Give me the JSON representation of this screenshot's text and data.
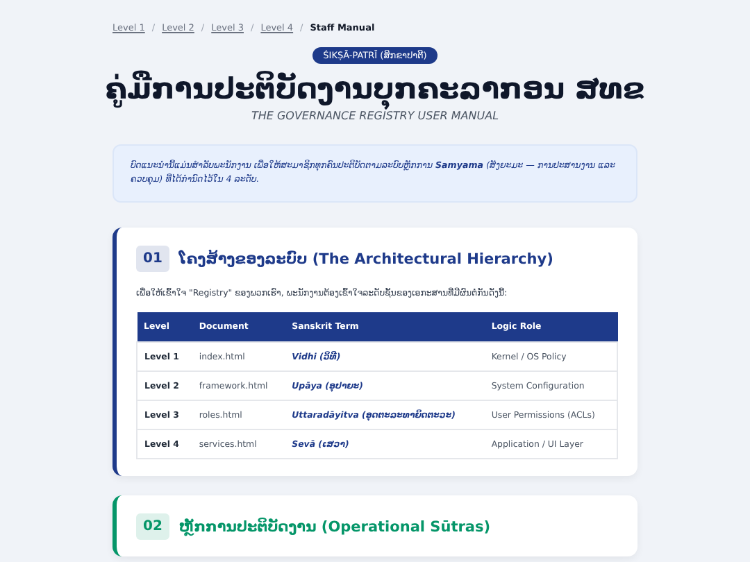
{
  "breadcrumb": {
    "separator": "/",
    "items": [
      {
        "label": "Level 1",
        "current": false
      },
      {
        "label": "Level 2",
        "current": false
      },
      {
        "label": "Level 3",
        "current": false
      },
      {
        "label": "Level 4",
        "current": false
      },
      {
        "label": "Staff Manual",
        "current": true
      }
    ]
  },
  "header": {
    "badge": "ŚIKṢĀ-PATRĪ (ສິກຂາປາຕີ)",
    "title": "ຄູ່ມືການປະຕິບັດງານບຸກຄະລາກອນ ສທຂ",
    "subtitle": "THE GOVERNANCE REGISTRY USER MANUAL"
  },
  "intro": "ບົດແນະນຳນີ້ແມ່ນສຳລັບພະນັກງານ ເພື່ອໃຫ້ສະມາຊິກທຸກຄົນປະຕິບັດຕາມລະບົບຫຼັກການ **Samyama** (ສັງຍະມະ — ການປະສານງານ ແລະ ຄວບຄຸມ) ທີ່ໄດ້ກຳນົດໄວ້ໃນ 4 ລະດັບ.",
  "sections": [
    {
      "number": "01",
      "title": "ໂຄງສ້າງຂອງລະບົບ (The Architectural Hierarchy)",
      "color": "#1e3a8a",
      "text": "ເພື່ອໃຫ້ເຂົ້າໃຈ \"Registry\" ຂອງພວກເຮົາ, ພະນັກງານຕ້ອງເຂົ້າໃຈລະດັບຊັ້ນຂອງເອກະສານທີ່ມີຜົນຕໍ່ກັນດັ່ງນີ້:",
      "table": {
        "columns": [
          "Level",
          "Document",
          "Sanskrit Term",
          "Logic Role"
        ],
        "rows": [
          [
            "Level 1",
            "index.html",
            "Vidhi (ວິທີ)",
            "Kernel / OS Policy"
          ],
          [
            "Level 2",
            "framework.html",
            "Upāya (ອຸປາຍະ)",
            "System Configuration"
          ],
          [
            "Level 3",
            "roles.html",
            "Uttaradāyitva (ອຸດຕະລະທາຍິດຕະວະ)",
            "User Permissions (ACLs)"
          ],
          [
            "Level 4",
            "services.html",
            "Sevā (ເສວາ)",
            "Application / UI Layer"
          ]
        ]
      }
    },
    {
      "number": "02",
      "title": "ຫຼັກການປະຕິບັດງານ (Operational Sūtras)",
      "color": "#059669"
    }
  ]
}
